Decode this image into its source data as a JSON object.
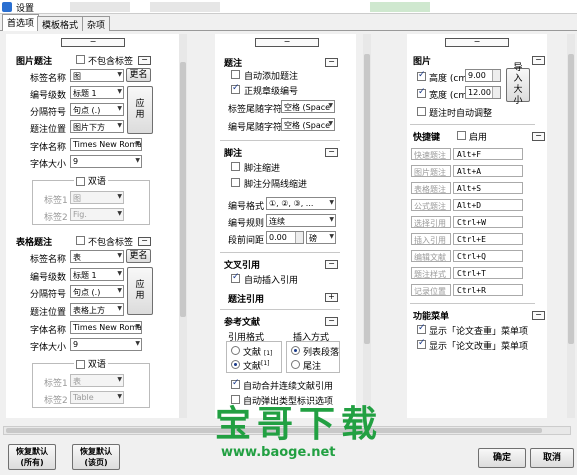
{
  "window": {
    "title": "设置"
  },
  "tabs": [
    "首选项",
    "模板格式",
    "杂项"
  ],
  "colA": {
    "fig": {
      "section": "图片题注",
      "no_label": "不包含标签",
      "lbl_name_label": "标签名称",
      "lbl_name_value": "图",
      "rename_button": "更名",
      "level_label": "编号级数",
      "level_value": "标题 1",
      "sep_label": "分隔符号",
      "sep_value": "句点 (.)",
      "apply_button": "应用",
      "pos_label": "题注位置",
      "pos_value": "图片下方",
      "font_label": "字体名称",
      "font_value": "Times New Roma",
      "size_label": "字体大小",
      "size_value": "9",
      "bilingual": "双语",
      "tag1_label": "标签1",
      "tag1_value": "图",
      "tag2_label": "标签2",
      "tag2_value": "Fig."
    },
    "tbl": {
      "section": "表格题注",
      "no_label": "不包含标签",
      "lbl_name_label": "标签名称",
      "lbl_name_value": "表",
      "rename_button": "更名",
      "level_label": "编号级数",
      "level_value": "标题 1",
      "sep_label": "分隔符号",
      "sep_value": "句点 (.)",
      "apply_button": "应用",
      "pos_label": "题注位置",
      "pos_value": "表格上方",
      "font_label": "字体名称",
      "font_value": "Times New Roma",
      "size_label": "字体大小",
      "size_value": "9",
      "bilingual": "双语",
      "tag1_label": "标签1",
      "tag1_value": "表",
      "tag2_label": "标签2",
      "tag2_value": "Table"
    }
  },
  "colB": {
    "caption": {
      "section": "题注",
      "auto_add": "自动添加题注",
      "chapter_num": "正规章级编号",
      "tag_suffix_label": "标签尾随字符",
      "tag_suffix_value": "空格 (Space",
      "num_suffix_label": "编号尾随字符",
      "num_suffix_value": "空格 (Space"
    },
    "footnote": {
      "section": "脚注",
      "indent": "脚注缩进",
      "sep_indent": "脚注分隔线缩进",
      "format_label": "编号格式",
      "format_value": "①, ②, ③, ...",
      "rule_label": "编号规则",
      "rule_value": "连续",
      "spacing_label": "段前间距",
      "spacing_value": "0.00",
      "spacing_unit": "磅"
    },
    "crossref": {
      "section": "文叉引用",
      "auto_insert": "自动插入引用",
      "caption_ref": "题注引用"
    },
    "biblio": {
      "section": "参考文献",
      "ref_format": "引用格式",
      "insert_mode": "插入方式",
      "opt1": "文献",
      "opt1_mark": "[1]",
      "opt2": "文献",
      "opt2_mark": "[1]",
      "opt3": "列表段落",
      "opt4": "尾注",
      "merge": "自动合并连续文献引用",
      "popup": "自动弹出类型标识选项"
    }
  },
  "colC": {
    "image": {
      "section": "图片",
      "height_label": "高度 (cm)",
      "height_value": "9.00",
      "width_label": "宽度 (cm)",
      "width_value": "12.00",
      "import_button": "导入大小",
      "auto_adjust": "题注时自动调整"
    },
    "hotkeys": {
      "section": "快捷键",
      "enable": "启用",
      "rows": [
        {
          "name": "快速题注",
          "key": "Alt+F"
        },
        {
          "name": "图片题注",
          "key": "Alt+A"
        },
        {
          "name": "表格题注",
          "key": "Alt+S"
        },
        {
          "name": "公式题注",
          "key": "Alt+D"
        },
        {
          "name": "选择引用",
          "key": "Ctrl+W"
        },
        {
          "name": "插入引用",
          "key": "Ctrl+E"
        },
        {
          "name": "编辑文献",
          "key": "Ctrl+Q"
        },
        {
          "name": "题注样式",
          "key": "Ctrl+T"
        },
        {
          "name": "记录位置",
          "key": "Ctrl+R"
        }
      ]
    },
    "menu": {
      "section": "功能菜单",
      "show_ref_check": "显示「论文查重」菜单项",
      "show_ref_edit": "显示「论文改重」菜单项"
    }
  },
  "footer": {
    "restore_all": "恢复默认\n(所有)",
    "restore_page": "恢复默认\n(该页)",
    "ok": "确定",
    "cancel": "取消"
  },
  "watermark": {
    "big": "宝哥下载",
    "url": "www.baoge.net"
  }
}
